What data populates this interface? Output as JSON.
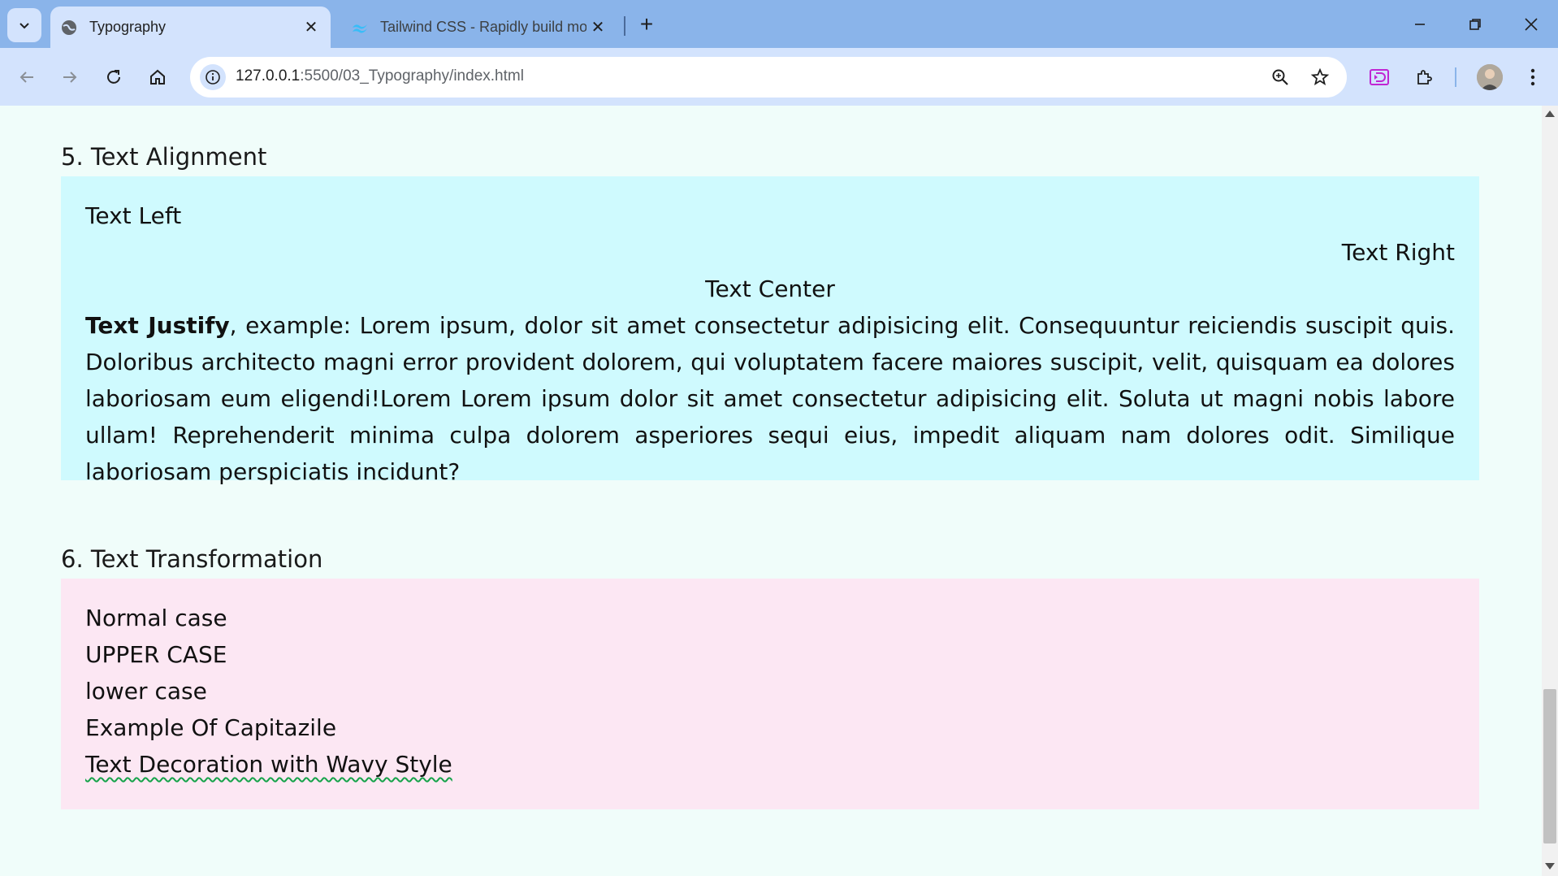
{
  "browser": {
    "tabs": [
      {
        "title": "Typography",
        "active": true
      },
      {
        "title": "Tailwind CSS - Rapidly build mo",
        "active": false
      }
    ],
    "url_host": "127.0.0.1",
    "url_rest": ":5500/03_Typography/index.html"
  },
  "sections": {
    "alignment": {
      "heading": "5. Text Alignment",
      "left": "Text Left",
      "right": "Text Right",
      "center": "Text Center",
      "justify_bold": "Text Justify",
      "justify_text": ", example: Lorem ipsum, dolor sit amet consectetur adipisicing elit. Consequuntur reiciendis suscipit quis. Doloribus architecto magni error provident dolorem, qui voluptatem facere maiores suscipit, velit, quisquam ea dolores laboriosam eum eligendi!Lorem Lorem ipsum dolor sit amet consectetur adipisicing elit. Soluta ut magni nobis labore ullam! Reprehenderit minima culpa dolorem asperiores sequi eius, impedit aliquam nam dolores odit. Similique laboriosam perspiciatis incidunt?"
    },
    "transformation": {
      "heading": "6. Text Transformation",
      "normal": "Normal case",
      "upper": "UPPER CASE",
      "lower": "lower case",
      "capitalize": "Example Of Capitazile",
      "wavy": "Text Decoration with Wavy Style"
    }
  },
  "colors": {
    "page_bg": "#f0fdfa",
    "cyan_box": "#cffafe",
    "pink_box": "#fce7f3",
    "wavy_underline": "#16a34a"
  }
}
